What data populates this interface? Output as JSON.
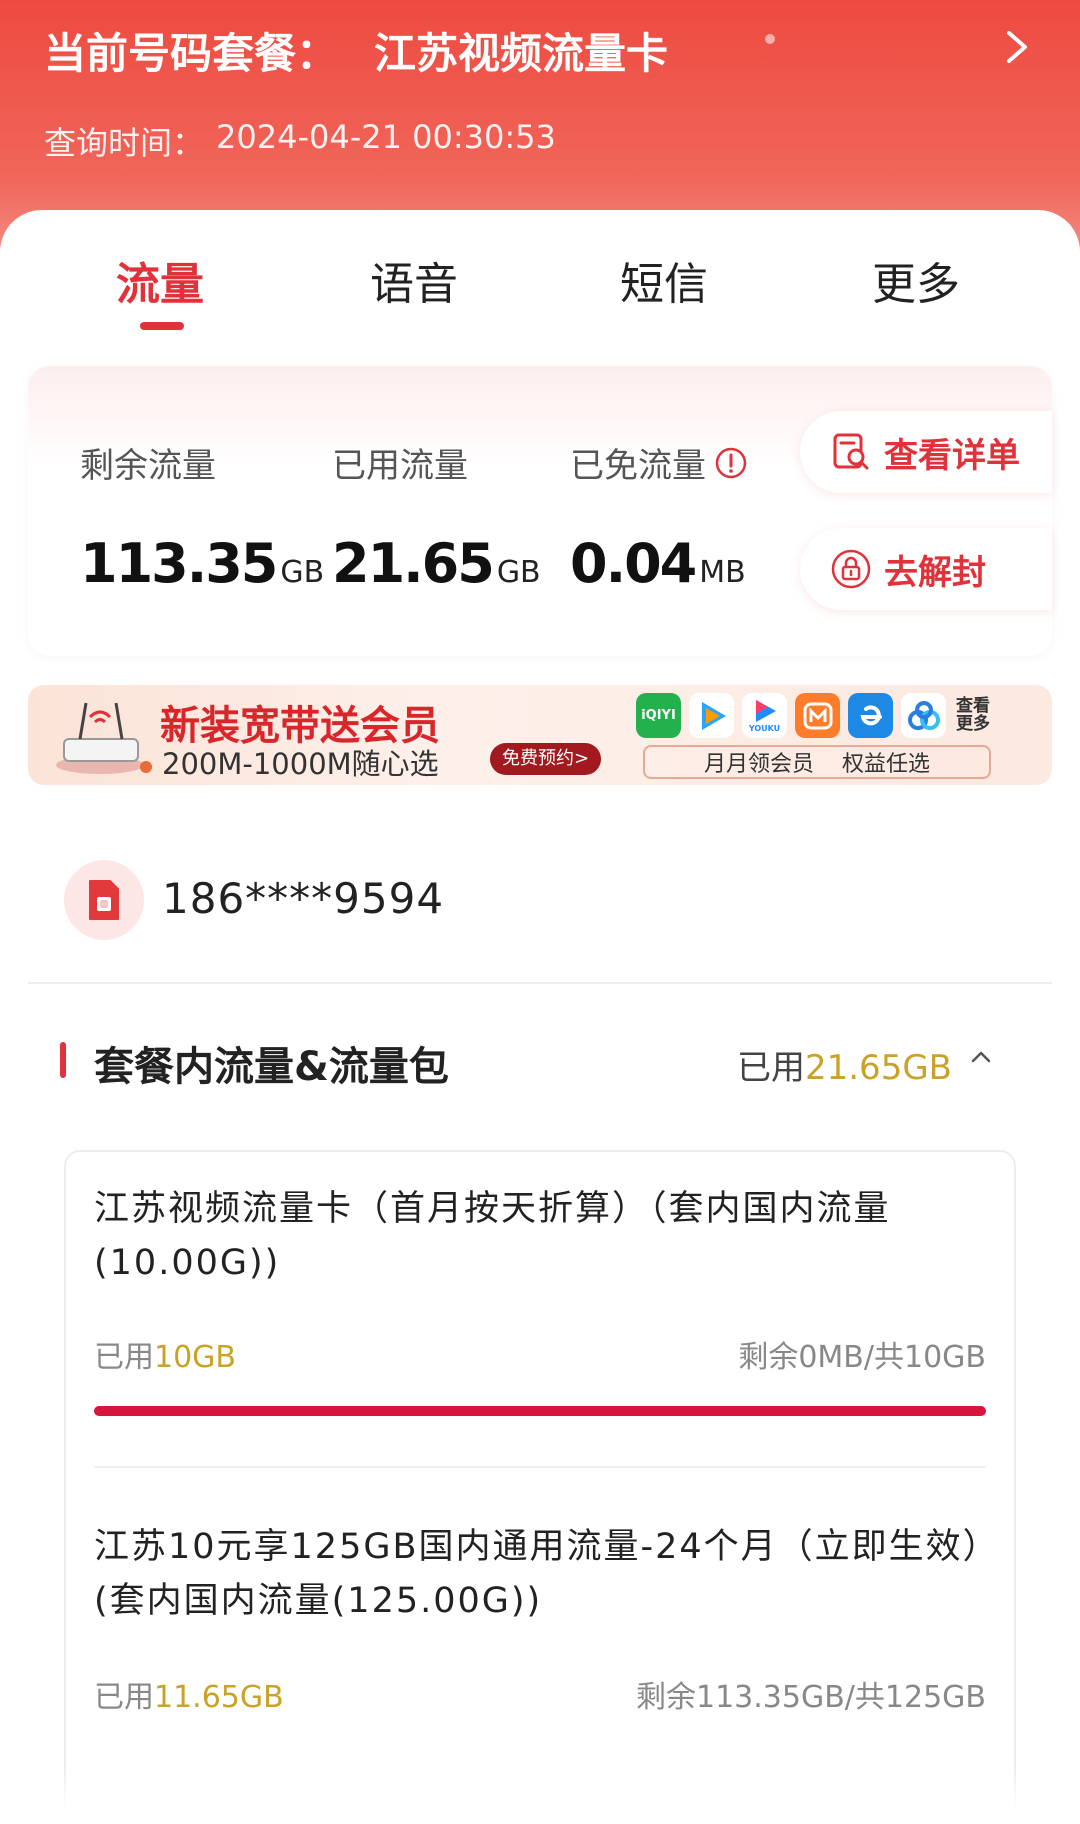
{
  "header": {
    "plan_label": "当前号码套餐：",
    "plan_name": "江苏视频流量卡",
    "query_label": "查询时间：",
    "query_time": "2024-04-21 00:30:53"
  },
  "tabs": [
    {
      "label": "流量",
      "active": true
    },
    {
      "label": "语音",
      "active": false
    },
    {
      "label": "短信",
      "active": false
    },
    {
      "label": "更多",
      "active": false
    }
  ],
  "usage": {
    "remaining": {
      "label": "剩余流量",
      "value": "113.35",
      "unit": "GB"
    },
    "used": {
      "label": "已用流量",
      "value": "21.65",
      "unit": "GB"
    },
    "exempt": {
      "label": "已免流量",
      "value": "0.04",
      "unit": "MB"
    },
    "details_button": "查看详单",
    "unblock_button": "去解封"
  },
  "banner": {
    "title": "新装宽带送会员",
    "subtitle": "200M-1000M随心选",
    "cta": "免费预约>",
    "apps": [
      "iQIYI",
      "tencent-video",
      "youku",
      "mgtv",
      "e-icon",
      "baidu-pan"
    ],
    "youku_label": "YOUKU",
    "view_more": "查看更多",
    "member_left": "月月领会员",
    "member_right": "权益任选"
  },
  "phone": {
    "number": "186****9594"
  },
  "package": {
    "title": "套餐内流量&流量包",
    "used_label": "已用",
    "used_amount": "21.65GB",
    "items": [
      {
        "title": "江苏视频流量卡（首月按天折算）（套内国内流量(10.00G))",
        "used_label": "已用",
        "used_amount": "10GB",
        "remain": "剩余0MB/共10GB",
        "progress": 1.0
      },
      {
        "title": "江苏10元享125GB国内通用流量-24个月（立即生效）(套内国内流量(125.00G))",
        "used_label": "已用",
        "used_amount": "11.65GB",
        "remain": "剩余113.35GB/共125GB"
      }
    ]
  },
  "colors": {
    "accent": "#e0323a",
    "gold": "#c9a227",
    "header": "#ee4a40"
  }
}
